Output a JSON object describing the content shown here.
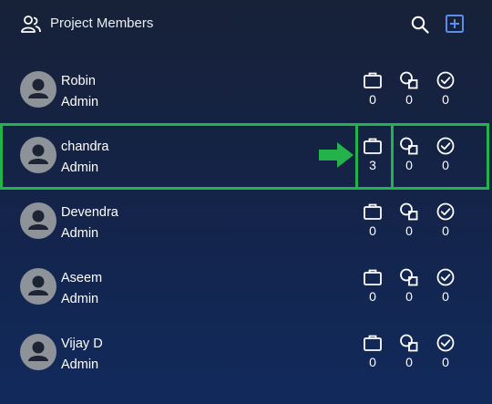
{
  "header": {
    "title": "Project Members",
    "icon": "members-icon",
    "actions": [
      "search-icon",
      "add-square-icon"
    ]
  },
  "stats_icons": [
    "briefcase-icon",
    "shapes-icon",
    "check-circle-icon"
  ],
  "members": [
    {
      "name": "Robin",
      "role": "Admin",
      "stats": [
        "0",
        "0",
        "0"
      ]
    },
    {
      "name": "chandra",
      "role": "Admin",
      "stats": [
        "3",
        "0",
        "0"
      ]
    },
    {
      "name": "Devendra",
      "role": "Admin",
      "stats": [
        "0",
        "0",
        "0"
      ]
    },
    {
      "name": "Aseem",
      "role": "Admin",
      "stats": [
        "0",
        "0",
        "0"
      ]
    },
    {
      "name": "Vijay D",
      "role": "Admin",
      "stats": [
        "0",
        "0",
        "0"
      ]
    }
  ],
  "colors": {
    "highlight": "#24b24a",
    "accent": "#5b8def",
    "avatar": "#8e9299"
  }
}
